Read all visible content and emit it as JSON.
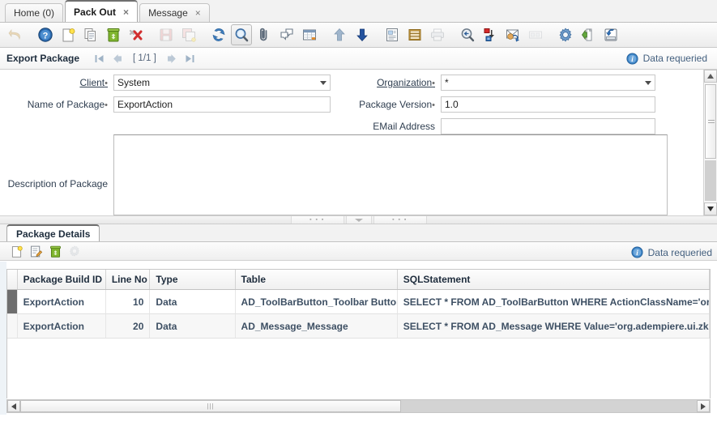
{
  "window_tabs": [
    {
      "label": "Home (0)",
      "closable": false,
      "active": false
    },
    {
      "label": "Pack Out",
      "closable": true,
      "close_label": "×",
      "active": true
    },
    {
      "label": "Message",
      "closable": true,
      "close_label": "×",
      "active": false
    }
  ],
  "toolbar": {
    "buttons": [
      {
        "name": "undo-icon",
        "title": "Undo",
        "state": "disabled"
      },
      {
        "name": "help-icon",
        "title": "Help",
        "state": "enabled"
      },
      {
        "name": "new-record-icon",
        "title": "New Record",
        "state": "enabled"
      },
      {
        "name": "copy-record-icon",
        "title": "Copy Record",
        "state": "enabled"
      },
      {
        "name": "delete-record-icon",
        "title": "Delete Record",
        "state": "enabled"
      },
      {
        "name": "delete-selection-icon",
        "title": "Delete Selection",
        "state": "enabled"
      },
      {
        "name": "save-icon",
        "title": "Save Changes",
        "state": "disabled"
      },
      {
        "name": "save-create-new-icon",
        "title": "Save and Create New",
        "state": "disabled"
      },
      {
        "name": "refresh-icon",
        "title": "Refresh",
        "state": "enabled"
      },
      {
        "name": "find-icon",
        "title": "Find",
        "state": "pressed"
      },
      {
        "name": "attachment-icon",
        "title": "Attachment",
        "state": "enabled"
      },
      {
        "name": "chat-icon",
        "title": "Chat",
        "state": "enabled"
      },
      {
        "name": "grid-toggle-icon",
        "title": "Toggle Grid View",
        "state": "enabled"
      },
      {
        "name": "parent-record-icon",
        "title": "Parent Record",
        "state": "enabled"
      },
      {
        "name": "detail-record-icon",
        "title": "Detail Record",
        "state": "enabled"
      },
      {
        "name": "report-icon",
        "title": "Report",
        "state": "enabled"
      },
      {
        "name": "archive-icon",
        "title": "Archived Documents",
        "state": "enabled"
      },
      {
        "name": "print-icon",
        "title": "Print",
        "state": "disabled"
      },
      {
        "name": "zoom-across-icon",
        "title": "Zoom Across",
        "state": "enabled"
      },
      {
        "name": "active-workflow-icon",
        "title": "Active Workflow",
        "state": "enabled"
      },
      {
        "name": "request-icon",
        "title": "Requests",
        "state": "enabled"
      },
      {
        "name": "product-info-icon",
        "title": "Product Info",
        "state": "disabled"
      },
      {
        "name": "preference-icon",
        "title": "Preference",
        "state": "enabled"
      },
      {
        "name": "export-icon",
        "title": "Export",
        "state": "enabled"
      },
      {
        "name": "exit-icon",
        "title": "Exit",
        "state": "enabled"
      }
    ]
  },
  "window_header": {
    "title": "Export Package",
    "nav": {
      "first_icon": "first-record-icon",
      "prev_icon": "previous-record-icon",
      "page_indicator": "[ 1/1 ]",
      "next_icon": "next-record-icon",
      "last_icon": "last-record-icon"
    },
    "status": {
      "icon": "info-icon",
      "text": "Data requeried"
    }
  },
  "form": {
    "fields": [
      {
        "name": "client",
        "label": "Client",
        "required_mark": "•",
        "underline": true,
        "type": "combo",
        "value": "System"
      },
      {
        "name": "organization",
        "label": "Organization",
        "required_mark": "•",
        "underline": true,
        "type": "combo",
        "value": "*"
      },
      {
        "name": "name-of-package",
        "label": "Name of Package",
        "required_mark": "•",
        "underline": false,
        "type": "text",
        "value": "ExportAction",
        "placeholder": ""
      },
      {
        "name": "package-version",
        "label": "Package Version",
        "required_mark": "•",
        "underline": false,
        "type": "text",
        "value": "1.0",
        "placeholder": ""
      },
      {
        "name": "email-address",
        "label": "EMail Address",
        "required_mark": "",
        "underline": false,
        "type": "text",
        "value": "",
        "placeholder": ""
      },
      {
        "name": "description-of-package",
        "label": "Description of Package",
        "required_mark": "",
        "underline": false,
        "type": "textarea",
        "value": "",
        "placeholder": ""
      }
    ]
  },
  "detail": {
    "tab_label": "Package Details",
    "toolbar_buttons": [
      {
        "name": "new-record-icon",
        "title": "New Record",
        "state": "enabled"
      },
      {
        "name": "edit-record-icon",
        "title": "Edit Record",
        "state": "enabled"
      },
      {
        "name": "delete-record-icon",
        "title": "Delete Record",
        "state": "enabled"
      },
      {
        "name": "process-icon",
        "title": "Process",
        "state": "disabled"
      }
    ],
    "status": {
      "icon": "info-icon",
      "text": "Data requeried"
    },
    "table": {
      "columns": [
        "Package Build ID",
        "Line No",
        "Type",
        "Table",
        "SQLStatement"
      ],
      "rows": [
        {
          "selected": true,
          "cells": [
            "ExportAction",
            "10",
            "Data",
            "AD_ToolBarButton_Toolbar Button",
            "SELECT * FROM AD_ToolBarButton WHERE ActionClassName='org..."
          ]
        },
        {
          "selected": false,
          "cells": [
            "ExportAction",
            "20",
            "Data",
            "AD_Message_Message",
            "SELECT * FROM AD_Message WHERE Value='org.adempiere.ui.zk..."
          ]
        }
      ]
    },
    "hscroll": {
      "left_arrow_icon": "scroll-left-icon",
      "right_arrow_icon": "scroll-right-icon",
      "grip": "|||"
    }
  },
  "form_scroll": {
    "up_arrow_icon": "scroll-up-icon",
    "down_arrow_icon": "scroll-down-icon"
  },
  "splitter": {
    "left_dots": "▪ ▪ ▪",
    "right_dots": "▪ ▪ ▪",
    "collapse_icon": "collapse-down-icon"
  },
  "colors": {
    "accent": "#3b6ea5",
    "status_text": "#44607f",
    "table_text": "#3d4f63",
    "selection_bar": "#6e6e6e"
  }
}
